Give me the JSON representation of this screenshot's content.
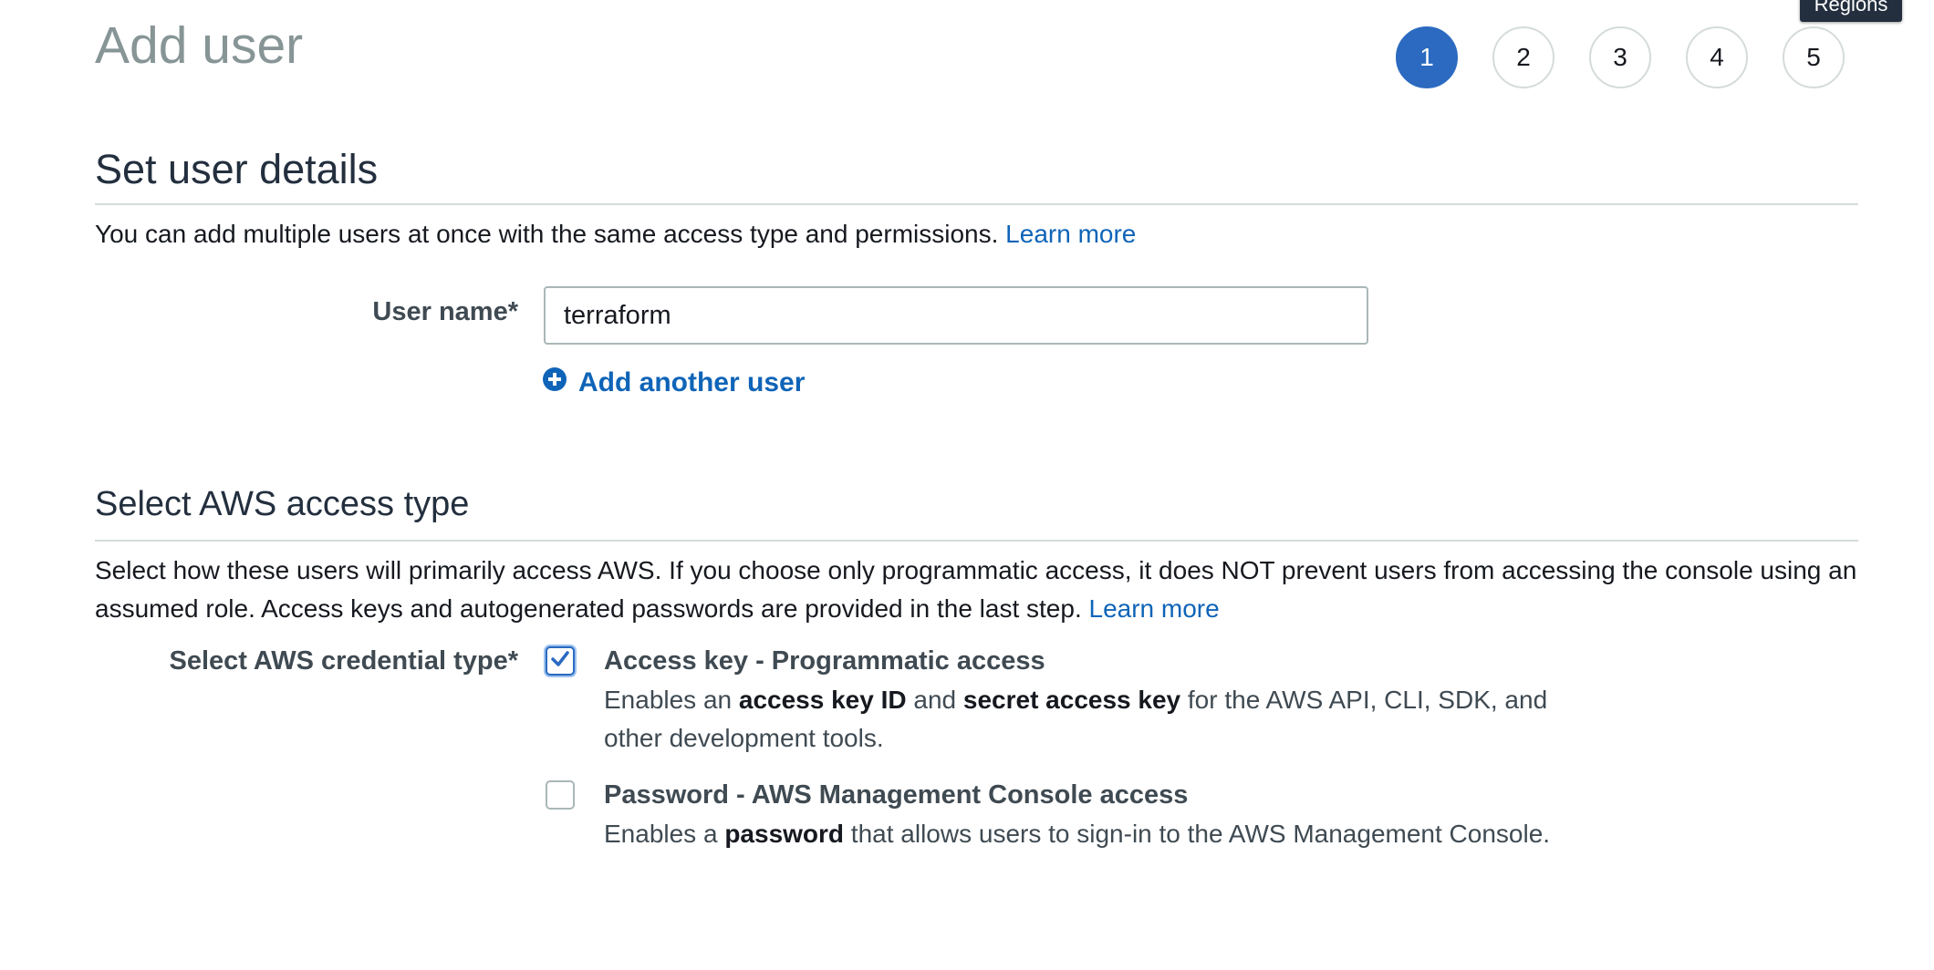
{
  "header": {
    "title": "Add user",
    "tooltip": "Regions"
  },
  "steps": [
    "1",
    "2",
    "3",
    "4",
    "5"
  ],
  "user_details": {
    "section_title": "Set user details",
    "description": "You can add multiple users at once with the same access type and permissions.",
    "learn_more": "Learn more",
    "user_name_label": "User name*",
    "user_name_value": "terraform",
    "add_another_user": "Add another user"
  },
  "access_type": {
    "section_title": "Select AWS access type",
    "description": "Select how these users will primarily access AWS. If you choose only programmatic access, it does NOT prevent users from accessing the console using an assumed role. Access keys and autogenerated passwords are provided in the last step.",
    "learn_more": "Learn more",
    "credential_label": "Select AWS credential type*",
    "options": [
      {
        "title": "Access key - Programmatic access",
        "checked": true,
        "desc": {
          "t1": "Enables an ",
          "b1": "access key ID",
          "t2": " and ",
          "b2": "secret access key",
          "t3": " for the AWS API, CLI, SDK, and other development tools."
        }
      },
      {
        "title": "Password - AWS Management Console access",
        "checked": false,
        "desc": {
          "t1": "Enables a ",
          "b1": "password",
          "t2": " that allows users to sign-in to the AWS Management Console."
        }
      }
    ]
  },
  "colors": {
    "accent": "#2b6ac0",
    "link": "#0f64b8",
    "title_gray": "#879596",
    "border": "#d5dbdb"
  },
  "icons": {
    "add": "plus-circle-icon",
    "check": "checkmark-icon"
  }
}
